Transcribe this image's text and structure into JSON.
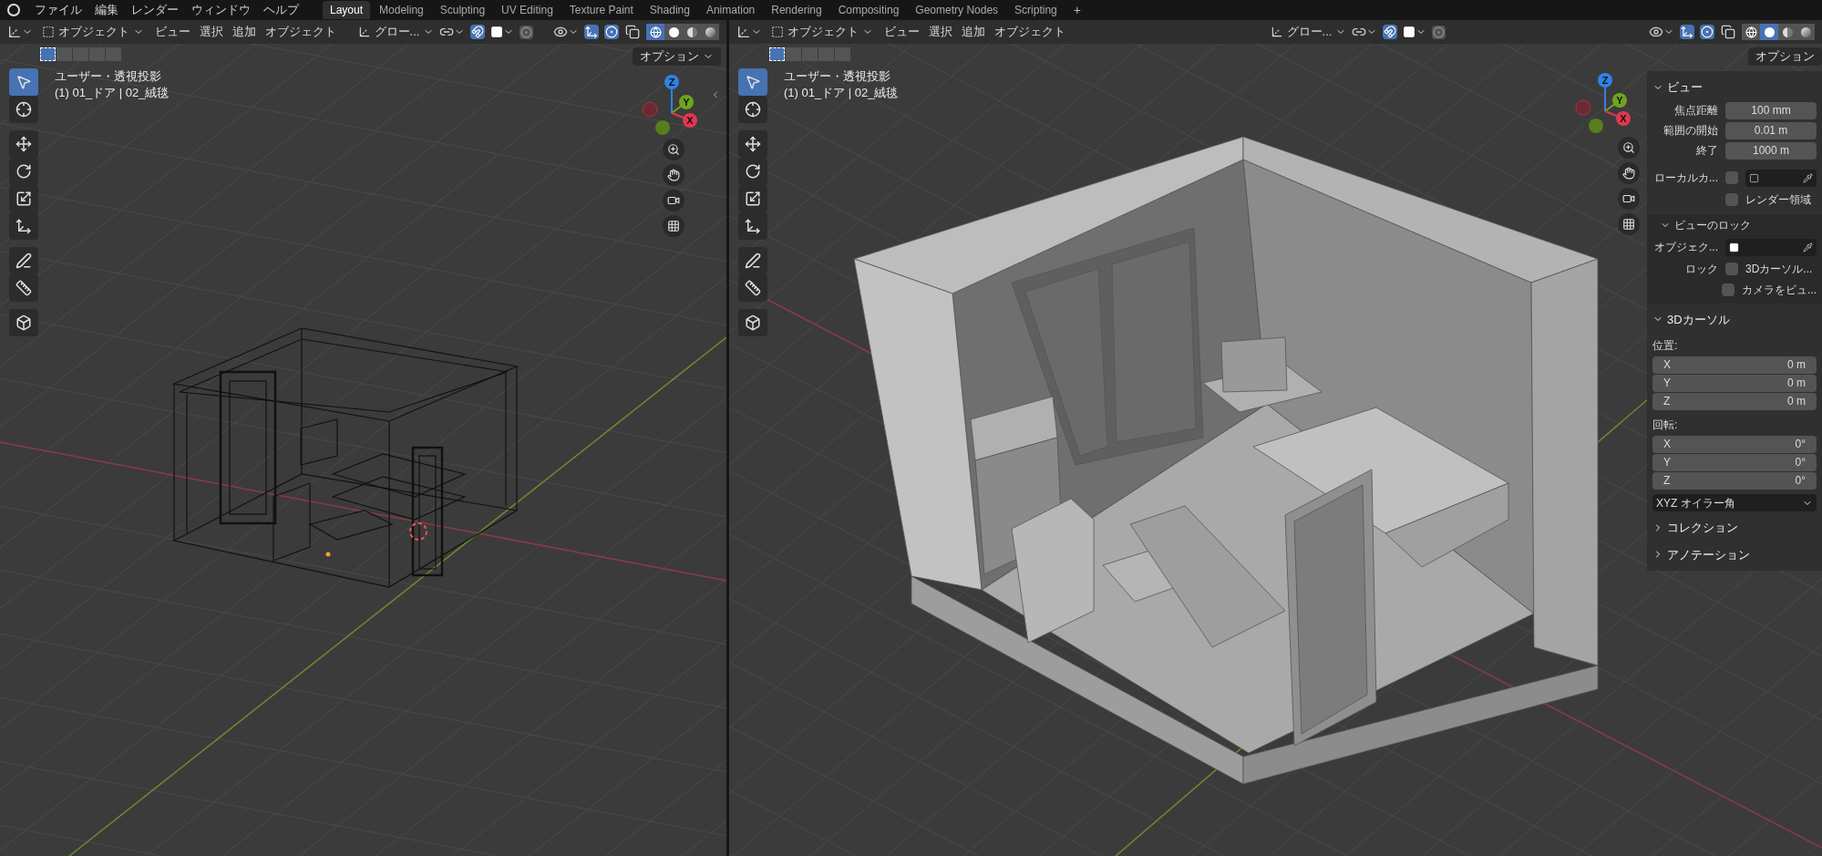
{
  "menu_bar": {
    "items": [
      "ファイル",
      "編集",
      "レンダー",
      "ウィンドウ",
      "ヘルプ"
    ]
  },
  "workspace_tabs": [
    {
      "label": "Layout",
      "selected": true
    },
    {
      "label": "Modeling",
      "selected": false
    },
    {
      "label": "Sculpting",
      "selected": false
    },
    {
      "label": "UV Editing",
      "selected": false
    },
    {
      "label": "Texture Paint",
      "selected": false
    },
    {
      "label": "Shading",
      "selected": false
    },
    {
      "label": "Animation",
      "selected": false
    },
    {
      "label": "Rendering",
      "selected": false
    },
    {
      "label": "Compositing",
      "selected": false
    },
    {
      "label": "Geometry Nodes",
      "selected": false
    },
    {
      "label": "Scripting",
      "selected": false
    }
  ],
  "add_workspace": "+",
  "viewports": [
    {
      "kind": "wireframe",
      "mode": "オブジェクト",
      "menus": [
        "ビュー",
        "選択",
        "追加",
        "オブジェクト"
      ],
      "orientation": "グロー...",
      "snap_on": true,
      "shading": [
        {
          "selected": true
        },
        {
          "selected": false
        },
        {
          "selected": false
        },
        {
          "selected": false
        }
      ],
      "select_modes": [
        {
          "selected": true
        },
        {
          "selected": false
        },
        {
          "selected": false
        },
        {
          "selected": false
        },
        {
          "selected": false
        }
      ],
      "options": "オプション",
      "view_name": "ユーザー・透視投影",
      "object_info": "(1) 01_ドア | 02_絨毯",
      "gizmo": [
        {
          "label": "Z",
          "color": "#2f82e6"
        },
        {
          "label": "Y",
          "color": "#6fa51c"
        },
        {
          "label": "X",
          "color": "#e0384f"
        }
      ],
      "tools": [
        {
          "kind": "select",
          "selected": true
        },
        {
          "kind": "cursor",
          "selected": false
        },
        {
          "kind": "move",
          "selected": false
        },
        {
          "kind": "rotate",
          "selected": false
        },
        {
          "kind": "scale",
          "selected": false
        },
        {
          "kind": "transform",
          "selected": false
        },
        {
          "kind": "annotate",
          "selected": false
        },
        {
          "kind": "measure",
          "selected": false
        },
        {
          "kind": "add_cube",
          "selected": false
        }
      ]
    },
    {
      "kind": "solid",
      "mode": "オブジェクト",
      "menus": [
        "ビュー",
        "選択",
        "追加",
        "オブジェクト"
      ],
      "orientation": "グロー...",
      "snap_on": true,
      "shading": [
        {
          "selected": false
        },
        {
          "selected": true
        },
        {
          "selected": false
        },
        {
          "selected": false
        }
      ],
      "select_modes": [
        {
          "selected": true
        },
        {
          "selected": false
        },
        {
          "selected": false
        },
        {
          "selected": false
        },
        {
          "selected": false
        }
      ],
      "options": "オプション",
      "view_name": "ユーザー・透視投影",
      "object_info": "(1) 01_ドア | 02_絨毯",
      "gizmo": [
        {
          "label": "Z",
          "color": "#2f82e6"
        },
        {
          "label": "Y",
          "color": "#6fa51c"
        },
        {
          "label": "X",
          "color": "#e0384f"
        }
      ],
      "tools": [
        {
          "kind": "select",
          "selected": true
        },
        {
          "kind": "cursor",
          "selected": false
        },
        {
          "kind": "move",
          "selected": false
        },
        {
          "kind": "rotate",
          "selected": false
        },
        {
          "kind": "scale",
          "selected": false
        },
        {
          "kind": "transform",
          "selected": false
        },
        {
          "kind": "annotate",
          "selected": false
        },
        {
          "kind": "measure",
          "selected": false
        },
        {
          "kind": "add_cube",
          "selected": false
        }
      ]
    }
  ],
  "sidebar": {
    "sections": [
      {
        "title": "ビュー",
        "expanded": true,
        "rows": [
          {
            "kind": "number",
            "label": "焦点距離",
            "value": "100 mm"
          },
          {
            "kind": "number",
            "label": "範囲の開始",
            "value": "0.01 m"
          },
          {
            "kind": "number",
            "label": "終了",
            "value": "1000 m"
          },
          {
            "kind": "picker",
            "label": "ローカルカ...",
            "checked": false
          },
          {
            "kind": "checkbox",
            "label": "レンダー領域",
            "checked": false
          },
          {
            "kind": "subsection",
            "title": "ビューのロック",
            "expanded": true,
            "rows": [
              {
                "kind": "object",
                "label": "オブジェク..."
              },
              {
                "kind": "checkbox",
                "group_label": "ロック",
                "label": "3Dカーソル...",
                "checked": false
              },
              {
                "kind": "checkbox",
                "label": "カメラをビュ...",
                "checked": false
              }
            ]
          }
        ]
      },
      {
        "title": "3Dカーソル",
        "expanded": true,
        "rows": [
          {
            "kind": "caption",
            "label": "位置:"
          },
          {
            "kind": "vector",
            "items": [
              {
                "axis": "X",
                "value": "0 m"
              },
              {
                "axis": "Y",
                "value": "0 m"
              },
              {
                "axis": "Z",
                "value": "0 m"
              }
            ]
          },
          {
            "kind": "caption",
            "label": "回転:"
          },
          {
            "kind": "vector",
            "items": [
              {
                "axis": "X",
                "value": "0°"
              },
              {
                "axis": "Y",
                "value": "0°"
              },
              {
                "axis": "Z",
                "value": "0°"
              }
            ]
          },
          {
            "kind": "dropdown",
            "value": "XYZ オイラー角"
          }
        ]
      },
      {
        "title": "コレクション",
        "expanded": false
      },
      {
        "title": "アノテーション",
        "expanded": false
      }
    ]
  }
}
